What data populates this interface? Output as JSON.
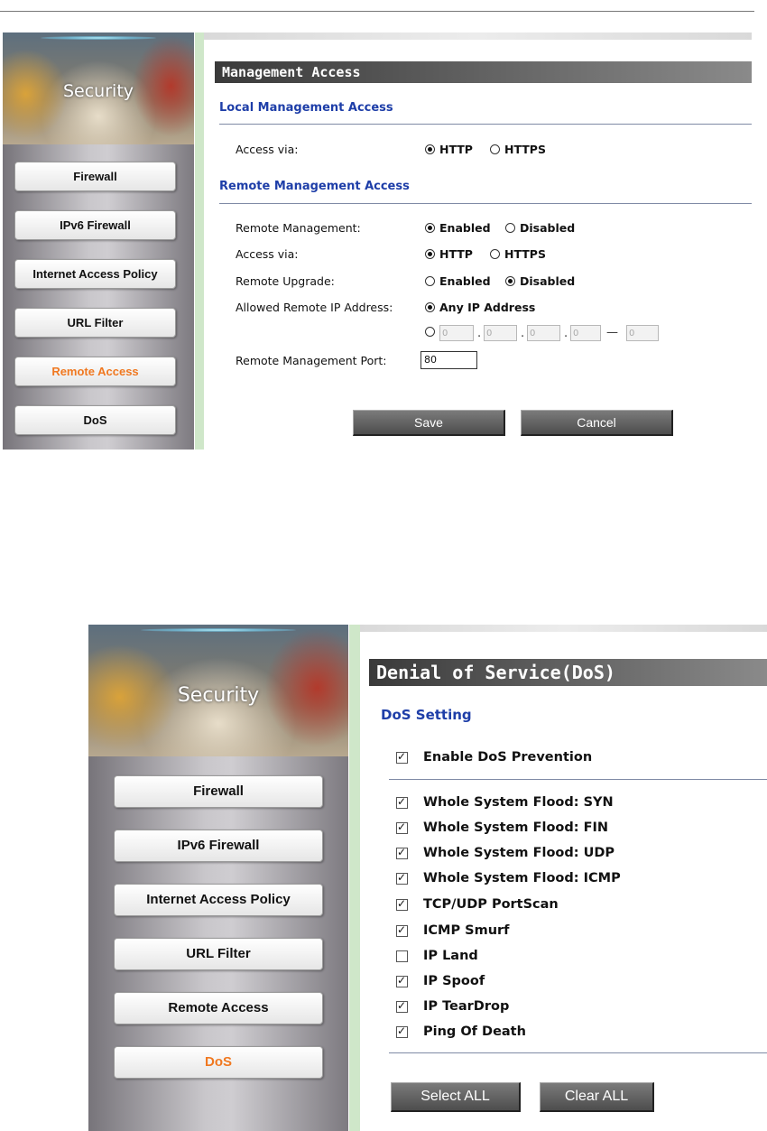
{
  "panel1": {
    "sidebar": {
      "banner_title": "Security",
      "items": [
        {
          "label": "Firewall",
          "active": false
        },
        {
          "label": "IPv6 Firewall",
          "active": false
        },
        {
          "label": "Internet Access Policy",
          "active": false
        },
        {
          "label": "URL Filter",
          "active": false
        },
        {
          "label": "Remote Access",
          "active": true
        },
        {
          "label": "DoS",
          "active": false
        }
      ]
    },
    "header": "Management Access",
    "local_section": {
      "title": "Local Management Access",
      "access_via_label": "Access via:",
      "options": [
        "HTTP",
        "HTTPS"
      ],
      "selected": "HTTP"
    },
    "remote_section": {
      "title": "Remote Management Access",
      "remote_management": {
        "label": "Remote Management:",
        "options": [
          "Enabled",
          "Disabled"
        ],
        "selected": "Enabled"
      },
      "access_via": {
        "label": "Access via:",
        "options": [
          "HTTP",
          "HTTPS"
        ],
        "selected": "HTTP"
      },
      "remote_upgrade": {
        "label": "Remote Upgrade:",
        "options": [
          "Enabled",
          "Disabled"
        ],
        "selected": "Disabled"
      },
      "allowed_ip": {
        "label": "Allowed Remote IP Address:",
        "any_ip_label": "Any IP Address",
        "any_selected": true,
        "ip_octets": [
          "0",
          "0",
          "0",
          "0"
        ],
        "range_end": "0"
      },
      "port": {
        "label": "Remote Management Port:",
        "value": "80"
      }
    },
    "buttons": {
      "save": "Save",
      "cancel": "Cancel"
    }
  },
  "panel2": {
    "sidebar": {
      "banner_title": "Security",
      "items": [
        {
          "label": "Firewall",
          "active": false
        },
        {
          "label": "IPv6 Firewall",
          "active": false
        },
        {
          "label": "Internet Access Policy",
          "active": false
        },
        {
          "label": "URL Filter",
          "active": false
        },
        {
          "label": "Remote Access",
          "active": false
        },
        {
          "label": "DoS",
          "active": true
        }
      ]
    },
    "header": "Denial of Service(DoS)",
    "section_title": "DoS Setting",
    "enable": {
      "label": "Enable DoS Prevention",
      "checked": true
    },
    "options": [
      {
        "label": "Whole System Flood: SYN",
        "checked": true
      },
      {
        "label": "Whole System Flood: FIN",
        "checked": true
      },
      {
        "label": "Whole System Flood: UDP",
        "checked": true
      },
      {
        "label": "Whole System Flood: ICMP",
        "checked": true
      },
      {
        "label": "TCP/UDP PortScan",
        "checked": true
      },
      {
        "label": "ICMP Smurf",
        "checked": true
      },
      {
        "label": "IP Land",
        "checked": false
      },
      {
        "label": "IP Spoof",
        "checked": true
      },
      {
        "label": "IP TearDrop",
        "checked": true
      },
      {
        "label": "Ping Of Death",
        "checked": true
      }
    ],
    "buttons": {
      "select_all": "Select ALL",
      "clear_all": "Clear ALL"
    }
  }
}
